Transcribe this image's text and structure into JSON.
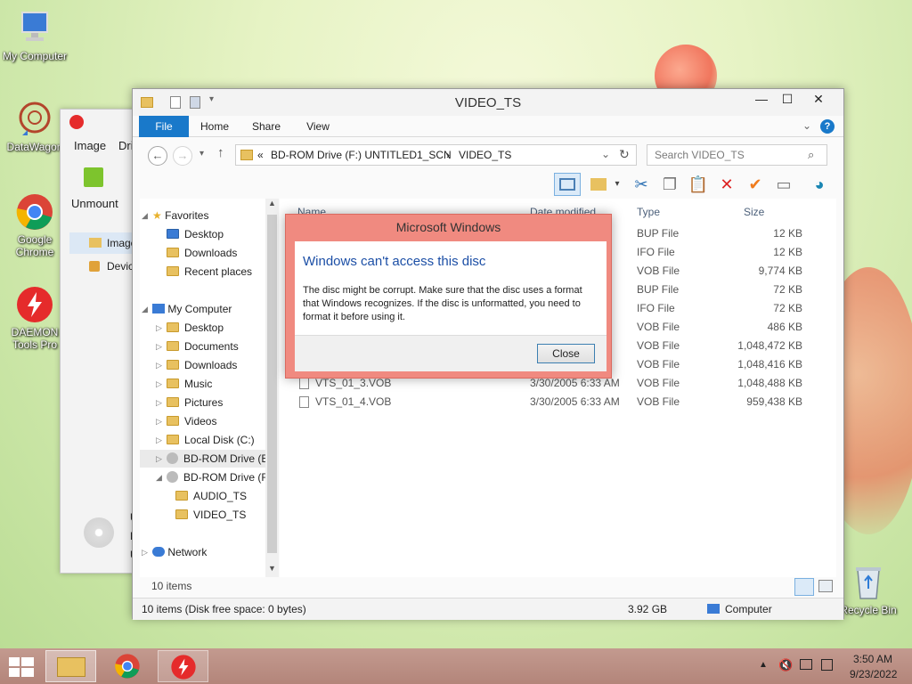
{
  "desktop": {
    "icons": [
      {
        "label": "My Computer"
      },
      {
        "label": "DataWagon"
      },
      {
        "label": "Google Chrome"
      },
      {
        "label": "DAEMON Tools Pro"
      },
      {
        "label": "Recycle Bin"
      }
    ]
  },
  "daemon_window": {
    "menu_image": "Image",
    "menu_partial": "Dri",
    "unmount_label": "Unmount",
    "side_items": [
      "Image",
      "Devic"
    ],
    "bottom_letters": [
      "U",
      "D",
      "U"
    ]
  },
  "explorer": {
    "title": "VIDEO_TS",
    "tabs": [
      "File",
      "Home",
      "Share",
      "View"
    ],
    "address": {
      "prefix": "«",
      "path1": "BD-ROM Drive (F:) UNTITLED1_SCN",
      "sep": "›",
      "path2": "VIDEO_TS"
    },
    "search_placeholder": "Search VIDEO_TS",
    "nav": {
      "favorites": "Favorites",
      "fav_items": [
        "Desktop",
        "Downloads",
        "Recent places"
      ],
      "computer": "My Computer",
      "computer_items": [
        "Desktop",
        "Documents",
        "Downloads",
        "Music",
        "Pictures",
        "Videos",
        "Local Disk (C:)",
        "BD-ROM Drive (E",
        "BD-ROM Drive (F"
      ],
      "sub_items": [
        "AUDIO_TS",
        "VIDEO_TS"
      ],
      "network": "Network"
    },
    "columns": {
      "name": "Name",
      "date": "Date modified",
      "type": "Type",
      "size": "Size"
    },
    "files": [
      {
        "name": "",
        "date": "",
        "type": "BUP File",
        "size": "12 KB"
      },
      {
        "name": "",
        "date": "",
        "type": "IFO File",
        "size": "12 KB"
      },
      {
        "name": "",
        "date": "",
        "type": "VOB File",
        "size": "9,774 KB"
      },
      {
        "name": "",
        "date": "",
        "type": "BUP File",
        "size": "72 KB"
      },
      {
        "name": "",
        "date": "",
        "type": "IFO File",
        "size": "72 KB"
      },
      {
        "name": "",
        "date": "",
        "type": "VOB File",
        "size": "486 KB"
      },
      {
        "name": "",
        "date": "",
        "type": "VOB File",
        "size": "1,048,472 KB"
      },
      {
        "name": "",
        "date": "",
        "type": "VOB File",
        "size": "1,048,416 KB"
      },
      {
        "name": "VTS_01_3.VOB",
        "date": "3/30/2005 6:33 AM",
        "type": "VOB File",
        "size": "1,048,488 KB"
      },
      {
        "name": "VTS_01_4.VOB",
        "date": "3/30/2005 6:33 AM",
        "type": "VOB File",
        "size": "959,438 KB"
      }
    ],
    "item_count": "10 items",
    "status": {
      "left": "10 items (Disk free space: 0 bytes)",
      "size": "3.92 GB",
      "location": "Computer"
    }
  },
  "dialog": {
    "title": "Microsoft Windows",
    "heading": "Windows can't access this disc",
    "message": "The disc might be corrupt. Make sure that the disc uses a format that Windows recognizes. If the disc is unformatted, you need to format it before using it.",
    "button": "Close"
  },
  "taskbar": {
    "time": "3:50 AM",
    "date": "9/23/2022"
  }
}
